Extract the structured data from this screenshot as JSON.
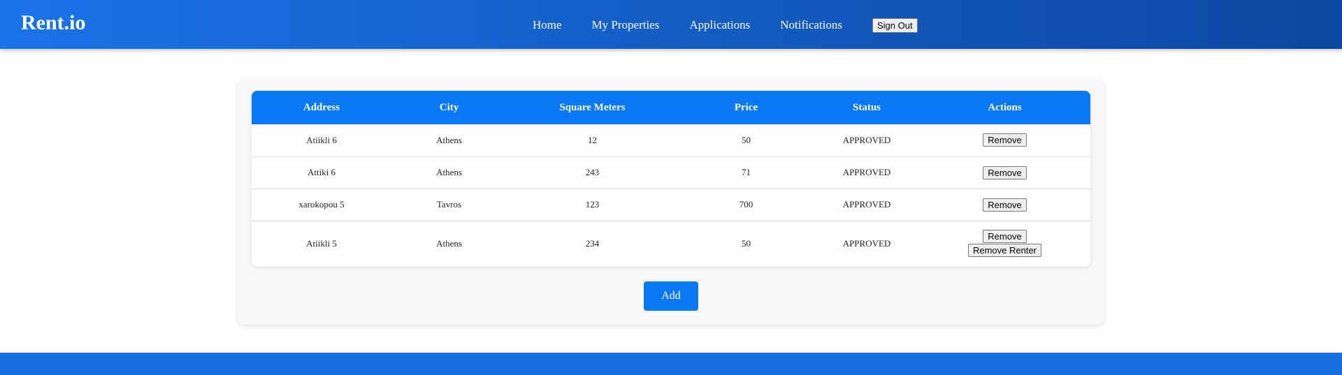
{
  "header": {
    "logo": "Rent.io",
    "nav": {
      "home": "Home",
      "my_properties": "My Properties",
      "applications": "Applications",
      "notifications": "Notifications",
      "sign_out": "Sign Out"
    }
  },
  "table": {
    "columns": [
      "Address",
      "City",
      "Square Meters",
      "Price",
      "Status",
      "Actions"
    ],
    "rows": [
      {
        "address": "Atiikli 6",
        "city": "Athens",
        "square_meters": "12",
        "price": "50",
        "status": "APPROVED",
        "actions": [
          "Remove"
        ]
      },
      {
        "address": "Attiki 6",
        "city": "Athens",
        "square_meters": "243",
        "price": "71",
        "status": "APPROVED",
        "actions": [
          "Remove"
        ]
      },
      {
        "address": "xarokopou 5",
        "city": "Tavros",
        "square_meters": "123",
        "price": "700",
        "status": "APPROVED",
        "actions": [
          "Remove"
        ]
      },
      {
        "address": "Atiikli 5",
        "city": "Athens",
        "square_meters": "234",
        "price": "50",
        "status": "APPROVED",
        "actions": [
          "Remove",
          "Remove Renter"
        ]
      }
    ]
  },
  "add_label": "Add",
  "colors": {
    "header_gradient_start": "#1a73e8",
    "header_gradient_end": "#0d47a1",
    "accent": "#0a78f4",
    "footer": "#1a6fe0"
  }
}
